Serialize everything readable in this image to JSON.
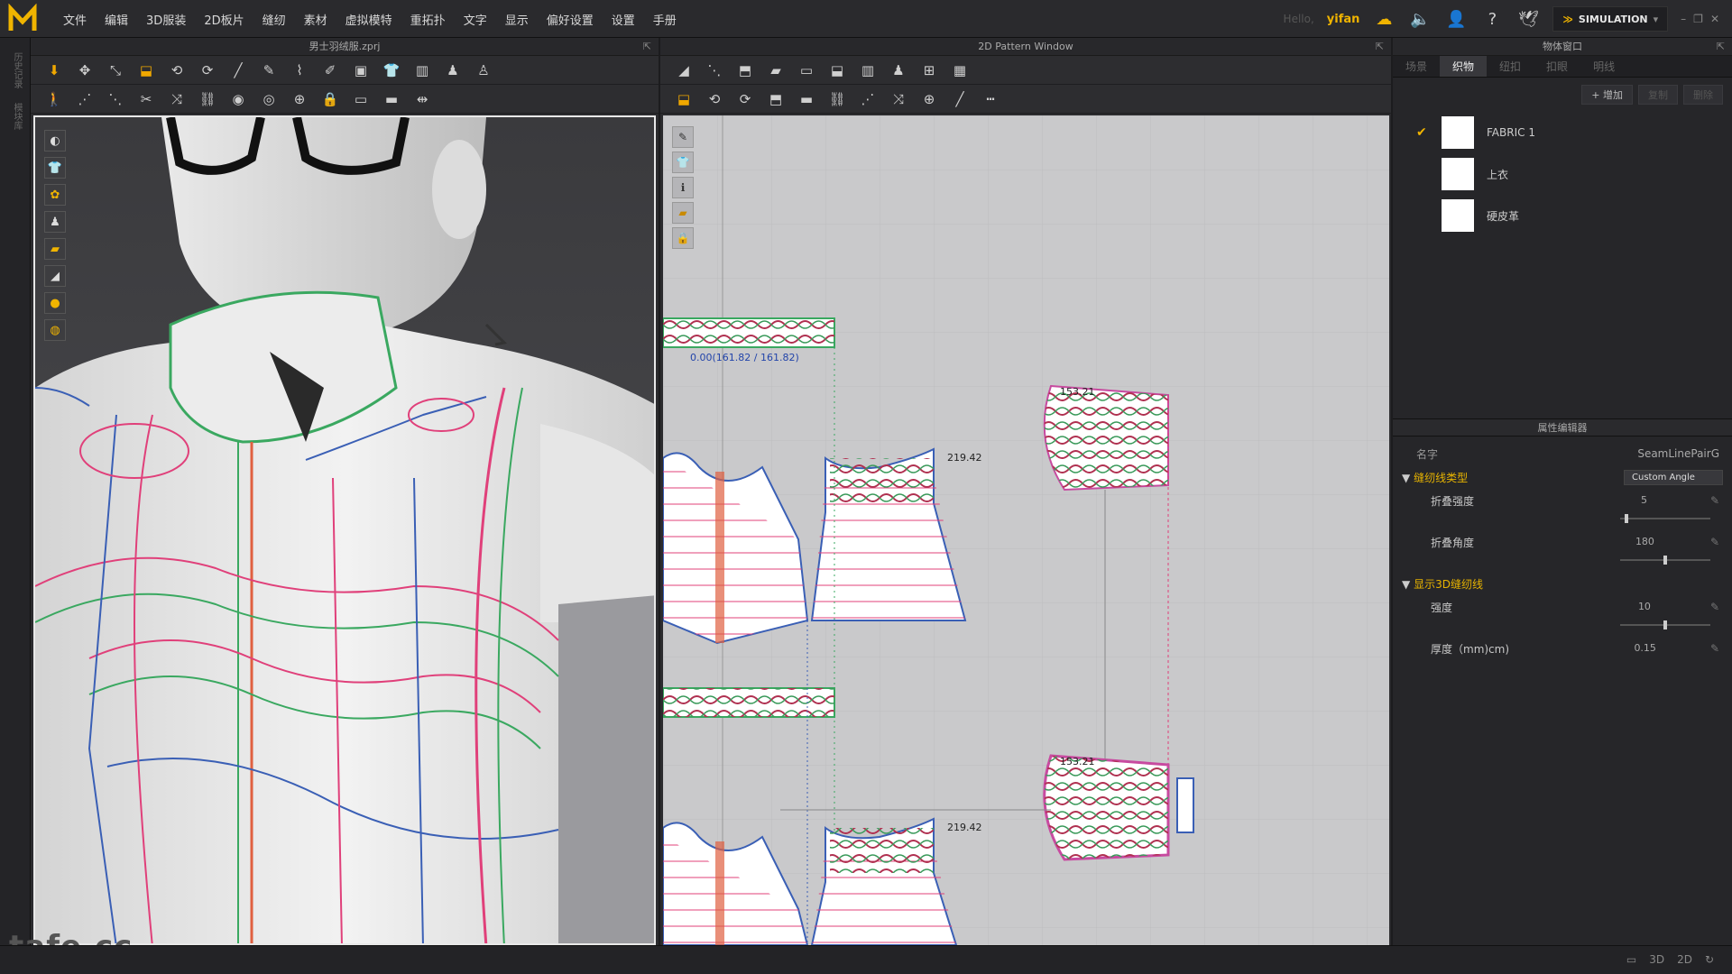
{
  "app": {
    "logo_letter": "M",
    "menu": [
      "文件",
      "编辑",
      "3D服装",
      "2D板片",
      "缝纫",
      "素材",
      "虚拟模特",
      "重拓扑",
      "文字",
      "显示",
      "偏好设置",
      "设置",
      "手册"
    ],
    "greeting": "Hello,",
    "username": "yifan",
    "mode": "SIMULATION",
    "icons": [
      "cloud-sync-icon",
      "speaker-icon",
      "user-icon",
      "help-icon",
      "bird-icon"
    ]
  },
  "left_strip": {
    "labels": [
      "历史记录",
      "模块库"
    ]
  },
  "panel3d": {
    "title": "男士羽绒服.zprj",
    "watermark": "tafe.cc"
  },
  "panel2d": {
    "title": "2D Pattern Window",
    "labels": {
      "seam_measure": "0.00(161.82 / 161.82)",
      "len_a": "219.42",
      "len_b": "153.21",
      "len_c": "219.42",
      "len_d": "153.21"
    }
  },
  "object_window": {
    "title": "物体窗口",
    "tabs": [
      "场景",
      "织物",
      "纽扣",
      "扣眼",
      "明线"
    ],
    "active_tab": "织物",
    "add_label": "+ 增加",
    "copy_label": "复制",
    "delete_label": "删除",
    "fabrics": [
      {
        "name": "FABRIC 1",
        "checked": true
      },
      {
        "name": "上衣",
        "checked": false
      },
      {
        "name": "硬皮革",
        "checked": false
      }
    ]
  },
  "property_editor": {
    "title": "属性编辑器",
    "name_label": "名字",
    "name_value": "SeamLinePairG",
    "section1": "缝纫线类型",
    "section1_value": "Custom Angle",
    "fold_strength_label": "折叠强度",
    "fold_strength_value": "5",
    "fold_strength_level": 0.05,
    "fold_angle_label": "折叠角度",
    "fold_angle_value": "180",
    "fold_angle_level": 0.5,
    "section2": "显示3D缝纫线",
    "intensity_label": "强度",
    "intensity_value": "10",
    "intensity_level": 0.5,
    "thickness_label": "厚度（mm)cm)",
    "thickness_value": "0.15"
  },
  "colors": {
    "accent": "#f0b400",
    "seam_pink": "#e0407a",
    "seam_green": "#3aa860",
    "seam_blue": "#3a5fb5"
  }
}
